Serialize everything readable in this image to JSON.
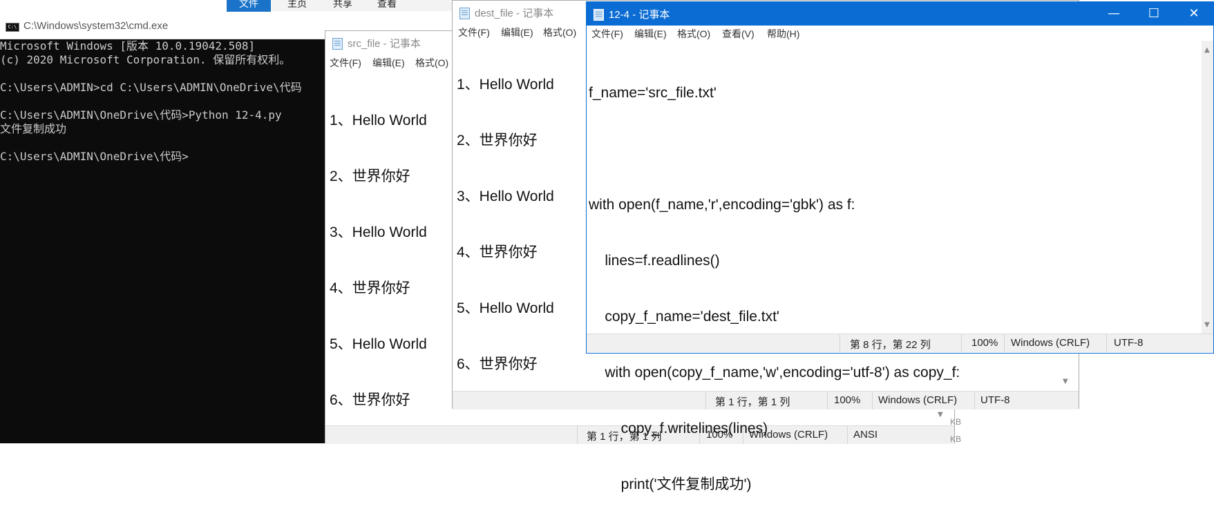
{
  "explorer_ribbon": {
    "tabs": [
      "文件",
      "主页",
      "共享",
      "查看"
    ]
  },
  "cmd": {
    "title": "C:\\Windows\\system32\\cmd.exe",
    "icon_text": "C:\\",
    "lines": [
      "Microsoft Windows [版本 10.0.19042.508]",
      "(c) 2020 Microsoft Corporation. 保留所有权利。",
      "",
      "C:\\Users\\ADMIN>cd C:\\Users\\ADMIN\\OneDrive\\代码",
      "",
      "C:\\Users\\ADMIN\\OneDrive\\代码>Python 12-4.py",
      "文件复制成功",
      "",
      "C:\\Users\\ADMIN\\OneDrive\\代码>"
    ]
  },
  "src_window": {
    "title": "src_file - 记事本",
    "menu": [
      "文件(F)",
      "编辑(E)",
      "格式(O)"
    ],
    "lines": [
      "1、Hello World",
      "2、世界你好",
      "3、Hello World",
      "4、世界你好",
      "5、Hello World",
      "6、世界你好"
    ],
    "status": {
      "position": "第 1 行，第 1 列",
      "zoom": "100%",
      "line_ending": "Windows (CRLF)",
      "encoding": "ANSI"
    },
    "size_labels": [
      "KB",
      "KB"
    ]
  },
  "dest_window": {
    "title": "dest_file - 记事本",
    "menu": [
      "文件(F)",
      "编辑(E)",
      "格式(O)"
    ],
    "lines": [
      "1、Hello World",
      "2、世界你好",
      "3、Hello World",
      "4、世界你好",
      "5、Hello World",
      "6、世界你好"
    ],
    "status": {
      "position": "第 1 行，第 1 列",
      "zoom": "100%",
      "line_ending": "Windows (CRLF)",
      "encoding": "UTF-8"
    }
  },
  "code_window": {
    "title": "12-4 - 记事本",
    "menu": [
      "文件(F)",
      "编辑(E)",
      "格式(O)",
      "查看(V)",
      "帮助(H)"
    ],
    "lines": [
      "f_name='src_file.txt'",
      "",
      "with open(f_name,'r',encoding='gbk') as f:",
      "    lines=f.readlines()",
      "    copy_f_name='dest_file.txt'",
      "    with open(copy_f_name,'w',encoding='utf-8') as copy_f:",
      "        copy_f.writelines(lines)",
      "        print('文件复制成功')"
    ],
    "status": {
      "position": "第 8 行，第 22 列",
      "zoom": "100%",
      "line_ending": "Windows (CRLF)",
      "encoding": "UTF-8"
    },
    "controls": {
      "minimize": "—",
      "maximize": "☐",
      "close": "✕"
    },
    "accent_color": "#0b6cd4"
  }
}
